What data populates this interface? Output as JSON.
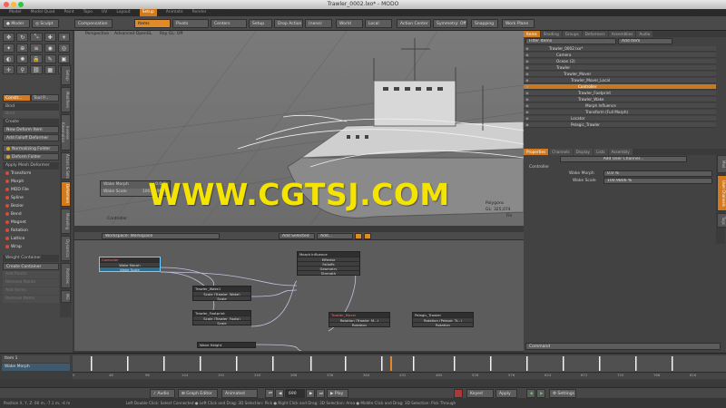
{
  "window": {
    "title": "Trawler_0002.lxo* - MODO"
  },
  "mode_tabs": [
    "Model",
    "Model Quad",
    "Paint",
    "Topo",
    "UV",
    "Layout",
    "Setup",
    "Animate",
    "Render"
  ],
  "active_mode": "Setup",
  "toolbar": {
    "model_label": "Model",
    "sculpt_label": "Sculpt",
    "compensation": "Compensation",
    "items": "Items",
    "pivots": "Pivots",
    "centers": "Centers",
    "setup": "Setup",
    "drop_action": "Drop Action",
    "drop_action_value": "(none)",
    "world": "World",
    "local": "Local",
    "action_center": "Action Center",
    "symmetry": "Symmetry: Off",
    "snapping": "Snapping",
    "work_plane": "Work Plane"
  },
  "left_panel": {
    "tabs": [
      "Constr...",
      "Tool P..."
    ],
    "bind_header": "Bind",
    "bind_item": "Bind",
    "create_header": "Create",
    "new_deform_item": "New Deform Item",
    "add_falloff": "Add Falloff Deformer",
    "normalizing_folder": "Normalizing Folder",
    "deform_folder": "Deform Folder",
    "apply_mesh_header": "Apply Mesh Deformer",
    "deformers": [
      "Transform",
      "Morph",
      "MDD File",
      "Spline",
      "Bezier",
      "Bend",
      "Magnet",
      "Rotation",
      "Lattice",
      "Wrap"
    ],
    "weight_header": "Weight Container",
    "create_container": "Create Container",
    "add_points": "Add Points",
    "remove_points": "Remove Points",
    "add_items": "Add Items",
    "remove_items": "Remove Items",
    "vertical_tabs": [
      "Setup",
      "Modifiers",
      "Inverse Kinematics",
      "Actors & Sets",
      "Deformers",
      "Modeling",
      "Dynamics",
      "Particles",
      "MG"
    ]
  },
  "viewport": {
    "labels": [
      "Perspective",
      "Advanced OpenGL",
      "Ray GL: Off"
    ],
    "popup_rows": [
      {
        "name": "Wake Morph",
        "value": "0.0 %"
      },
      {
        "name": "Wake Scale",
        "value": "100.9806 %"
      }
    ],
    "item_label": "Controller",
    "poly_info": "Polygons",
    "gl_info": "GL: 325,074",
    "poly_unit": "Fin"
  },
  "watermark": "WWW.CGTSJ.COM",
  "schematic": {
    "workspace": "Workspace: Workspace",
    "add_selected": "Add Selected",
    "add_dropdown": "Add...",
    "nodes": {
      "controller": {
        "title": "Controller",
        "rows": [
          "Wake Morph",
          "Wake Scale"
        ]
      },
      "morph": {
        "title": "Morph Influence",
        "rows": [
          "Effector",
          "Falloffs",
          "Geometry",
          "Strength"
        ]
      },
      "wake1": {
        "title": "Trawler_Wake1",
        "rows": [
          "Scale (Trawler_Wake)",
          "Scale"
        ]
      },
      "footprint": {
        "title": "Trawler_Footprint",
        "rows": [
          "Scale (Trawler_Footp)",
          "Scale"
        ]
      },
      "mover": {
        "title": "Trawler_Mover",
        "rows": [
          "Rotation (Trawler_M...)",
          "Rotation"
        ]
      },
      "pelagic": {
        "title": "Pelagic_Trawler",
        "rows": [
          "Rotation (Pelagic_Tr...)",
          "Rotation"
        ]
      },
      "waveheight": {
        "title": "Wave Height"
      }
    }
  },
  "right_panel": {
    "tabs": [
      "Items",
      "Shading",
      "Groups",
      "Deformers",
      "Assemblies",
      "Audio"
    ],
    "filter": "Filter Items",
    "add_item": "Add Item",
    "tree": [
      {
        "label": "Trawler_0002.lxo*",
        "indent": 0
      },
      {
        "label": "Camera",
        "indent": 1
      },
      {
        "label": "Ocean (2)",
        "indent": 1
      },
      {
        "label": "Trawler",
        "indent": 1
      },
      {
        "label": "Trawler_Mover",
        "indent": 2
      },
      {
        "label": "Trawler_Mover_Local",
        "indent": 3
      },
      {
        "label": "Controller",
        "indent": 4,
        "selected": true
      },
      {
        "label": "Trawler_Footprint",
        "indent": 4
      },
      {
        "label": "Trawler_Wake",
        "indent": 4
      },
      {
        "label": "Morph Influence",
        "indent": 5
      },
      {
        "label": "Transform (Full Morph)",
        "indent": 5
      },
      {
        "label": "Locator",
        "indent": 3
      },
      {
        "label": "Pelagic_Trawler",
        "indent": 3
      }
    ],
    "prop_tabs": [
      "Properties",
      "Channels",
      "Display",
      "Lists",
      "Assembly"
    ],
    "add_user_channel": "Add User Channel...",
    "controller_label": "Controller",
    "wake_morph_label": "Wake Morph",
    "wake_morph_value": "0.0 %",
    "wake_scale_label": "Wake Scale",
    "wake_scale_value": "100.9806 %",
    "side_tabs": [
      "Mod",
      "User Channels",
      "Tags"
    ],
    "command": "Command"
  },
  "timeline": {
    "track1": "Item 1",
    "track2": "Wake Morph",
    "ticks": [
      "0",
      "48",
      "96",
      "144",
      "192",
      "240",
      "288",
      "336",
      "384",
      "432",
      "480",
      "528",
      "576",
      "624",
      "672",
      "720",
      "768",
      "816"
    ]
  },
  "transport": {
    "audio": "Audio",
    "graph_editor": "Graph Editor",
    "animated": "Animated",
    "frame": "690",
    "play": "Play",
    "keyed": "Keyed",
    "apply": "Apply",
    "settings": "Settings"
  },
  "status": {
    "position": "Position X, Y, Z:   60 m, -7.1 m, -4 m",
    "hint": "Left Double Click: Select Connected ● Left Click and Drag: 3D Selection: Pick ● Right Click and Drag: 3D Selection: Area ● Middle Click and Drag: 3D Selection: Pick Through"
  }
}
